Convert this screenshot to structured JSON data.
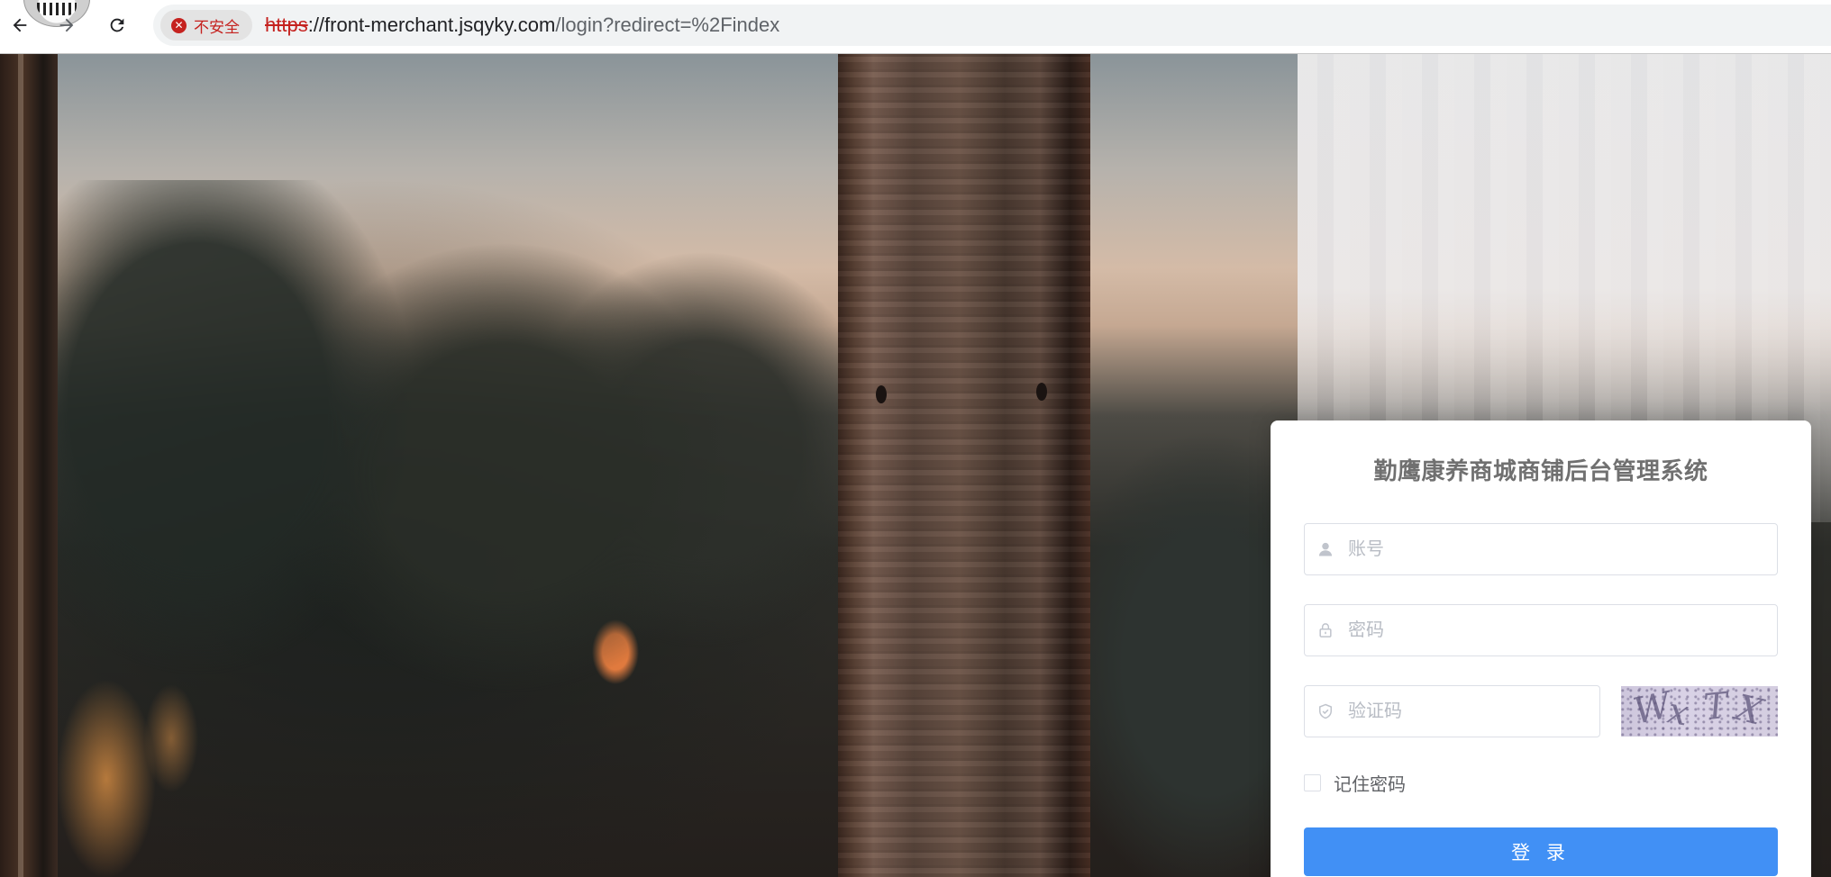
{
  "browser": {
    "security_label": "不安全",
    "url_scheme": "https",
    "url_host": "://front-merchant.jsqyky.com",
    "url_path": "/login?redirect=%2Findex"
  },
  "login": {
    "title": "勤鹰康养商城商铺后台管理系统",
    "username_placeholder": "账号",
    "password_placeholder": "密码",
    "captcha_placeholder": "验证码",
    "remember_label": "记住密码",
    "submit_label": "登 录",
    "remember_checked": false
  },
  "colors": {
    "primary": "#4190f5",
    "danger": "#c5221f",
    "title_text": "#707070"
  },
  "icons": [
    "back-arrow-icon",
    "forward-arrow-icon",
    "reload-icon",
    "not-secure-icon",
    "user-icon",
    "lock-icon",
    "shield-check-icon"
  ]
}
